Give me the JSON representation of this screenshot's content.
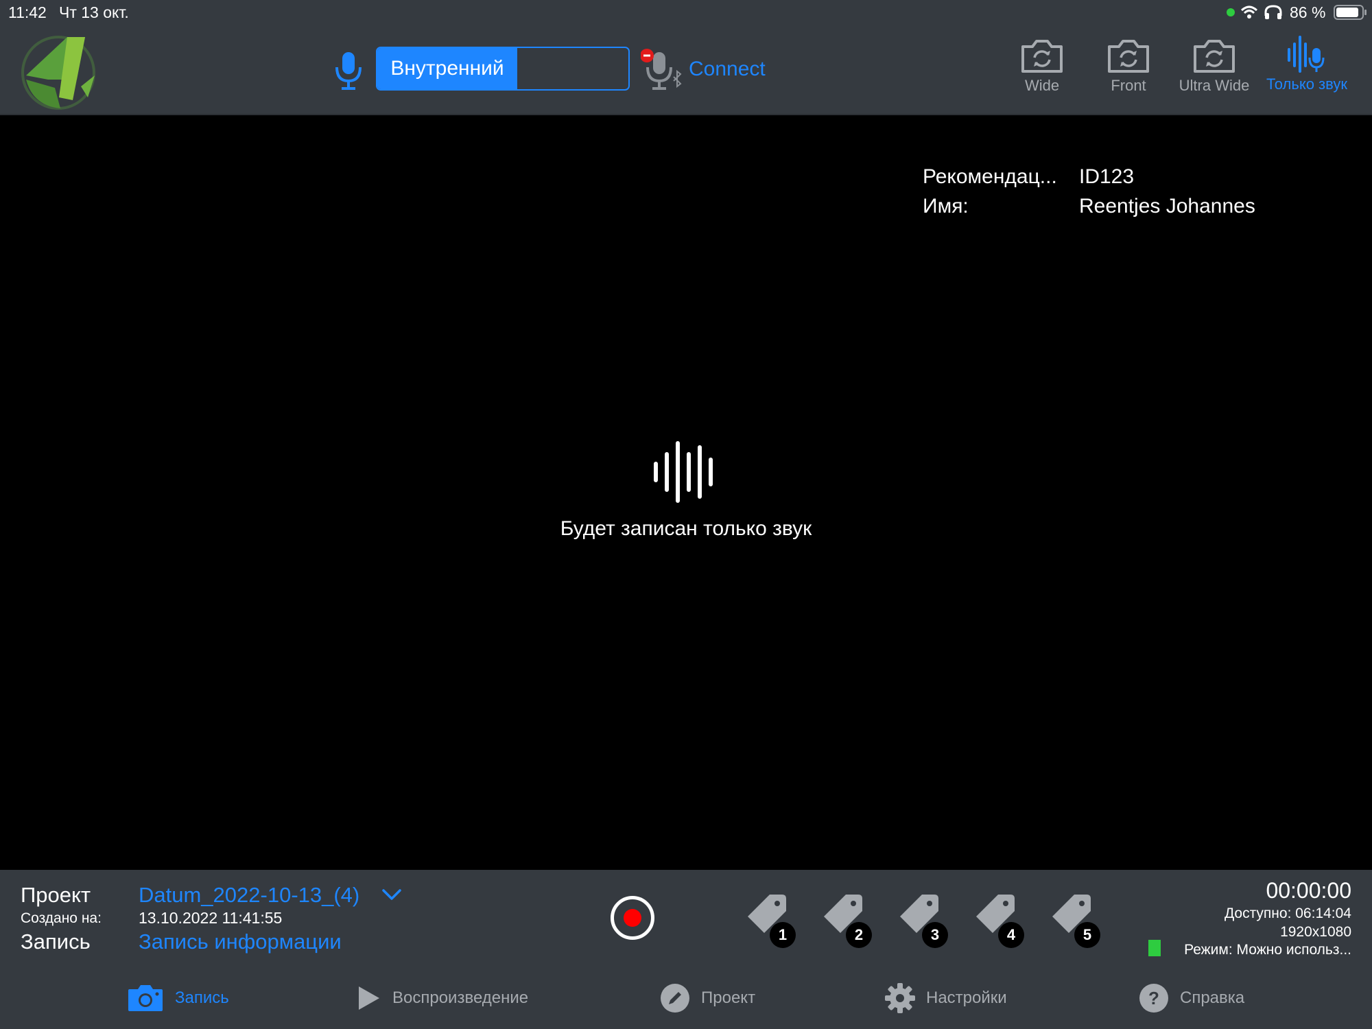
{
  "status_bar": {
    "time": "11:42",
    "date": "Чт 13 окт.",
    "battery": "86 %"
  },
  "header": {
    "mic_source_selected": "Внутренний",
    "connect_label": "Connect",
    "cameras": [
      {
        "label": "Wide",
        "active": false
      },
      {
        "label": "Front",
        "active": false
      },
      {
        "label": "Ultra Wide",
        "active": false
      },
      {
        "label": "Только звук",
        "active": true
      }
    ]
  },
  "info": {
    "rows": [
      {
        "key": "Рекомендац...",
        "value": "ID123"
      },
      {
        "key": "Имя:",
        "value": "Reentjes Johannes"
      }
    ]
  },
  "main": {
    "audio_only_message": "Будет записан только звук"
  },
  "project": {
    "project_label": "Проект",
    "project_name": "Datum_2022-10-13_(4)",
    "created_label": "Создано на:",
    "created_value": "13.10.2022 11:41:55",
    "record_label": "Запись",
    "record_info_link": "Запись информации"
  },
  "tags": [
    "1",
    "2",
    "3",
    "4",
    "5"
  ],
  "recording": {
    "timer": "00:00:00",
    "available": "Доступно: 06:14:04",
    "resolution": "1920x1080",
    "mode": "Режим: Можно использ..."
  },
  "tabs": [
    {
      "label": "Запись",
      "active": true
    },
    {
      "label": "Воспроизведение",
      "active": false
    },
    {
      "label": "Проект",
      "active": false
    },
    {
      "label": "Настройки",
      "active": false
    },
    {
      "label": "Справка",
      "active": false
    }
  ],
  "colors": {
    "accent": "#1e86ff",
    "panel": "#353a40",
    "record": "#ff0000",
    "mode_indicator": "#2ecc40",
    "logo_green": "#5aa03c"
  }
}
